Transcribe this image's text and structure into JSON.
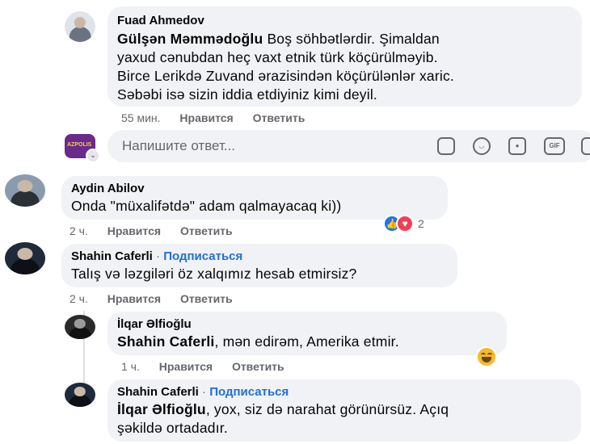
{
  "comments": [
    {
      "author": "Fuad Ahmedov",
      "mention": "Gülşən Məmmədoğlu",
      "lines": [
        "Boş söhbətlərdir. Şimaldan",
        "yaxud cənubdan heç vaxt etnik türk köçürülməyib.",
        "Birce Lerikdə Zuvand ərazisindən köçürülənlər xaric.",
        "Səbəbi isə sizin iddia etdiyiniz kimi deyil."
      ],
      "time": "55 мин.",
      "like": "Нравится",
      "reply": "Ответить"
    },
    {
      "author": "Aydin Abilov",
      "text": "Onda \"müxalifətdə\" adam qalmayacaq ki))",
      "time": "2 ч.",
      "like": "Нравится",
      "reply": "Ответить",
      "reaction_count": "2"
    },
    {
      "author": "Shahin Caferli",
      "follow": "Подписаться",
      "text": "Talış və ləzgiləri öz xalqımız hesab etmirsiz?",
      "time": "2 ч.",
      "like": "Нравится",
      "reply": "Ответить"
    },
    {
      "author": "İlqar Əlfioğlu",
      "mention": "Shahin Caferli",
      "text": ", mən edirəm, Amerika etmir.",
      "time": "1 ч.",
      "like": "Нравится",
      "reply": "Ответить"
    },
    {
      "author": "Shahin Caferli",
      "follow": "Подписаться",
      "mention": "İlqar Əlfioğlu",
      "lines": [
        ", yox, siz də narahat görünürsüz. Açıq",
        "şəkildə ortadadır."
      ]
    }
  ],
  "reply_box": {
    "placeholder": "Напишите ответ...",
    "avatar_text": "AZPOLIS"
  },
  "separator": "·",
  "colors": {
    "accent": "#216fdb",
    "bubble": "#f0f2f5",
    "muted": "#65676b"
  }
}
